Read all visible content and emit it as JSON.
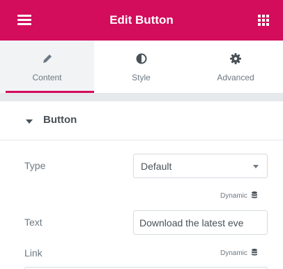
{
  "header": {
    "title": "Edit Button",
    "menu_icon": "hamburger-icon",
    "grid_icon": "apps-grid-icon",
    "background": "#d30c5c"
  },
  "tabs": [
    {
      "label": "Content",
      "icon": "pencil-icon",
      "active": true
    },
    {
      "label": "Style",
      "icon": "half-circle-icon",
      "active": false
    },
    {
      "label": "Advanced",
      "icon": "gear-icon",
      "active": false
    }
  ],
  "section": {
    "title": "Button",
    "expanded": true
  },
  "fields": {
    "type": {
      "label": "Type",
      "value": "Default",
      "dynamic_label": "Dynamic"
    },
    "text": {
      "label": "Text",
      "value": "Download the latest eve"
    },
    "link": {
      "label": "Link",
      "dynamic_label": "Dynamic"
    }
  },
  "colors": {
    "accent": "#d30c5c",
    "panel_bg": "#f1f3f5",
    "text": "#6d7882",
    "heading": "#495157"
  }
}
